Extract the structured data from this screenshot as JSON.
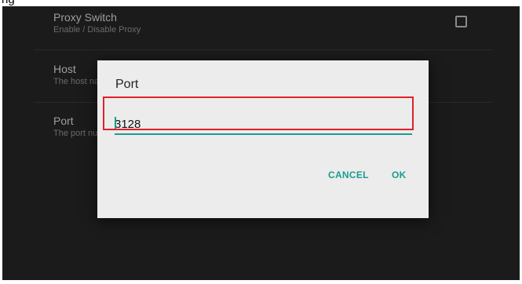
{
  "header": {
    "partial_label": "ng"
  },
  "preferences": [
    {
      "title": "Proxy Switch",
      "summary": "Enable / Disable Proxy"
    },
    {
      "title": "Host",
      "summary": "The host name"
    },
    {
      "title": "Port",
      "summary": "The port number"
    }
  ],
  "dialog": {
    "title": "Port",
    "input_value": "3128",
    "cancel_label": "CANCEL",
    "ok_label": "OK"
  },
  "colors": {
    "accent": "#1a9d8f",
    "highlight_box": "#e0202a",
    "background": "#1b1b1b",
    "dialog_bg": "#ececec"
  }
}
